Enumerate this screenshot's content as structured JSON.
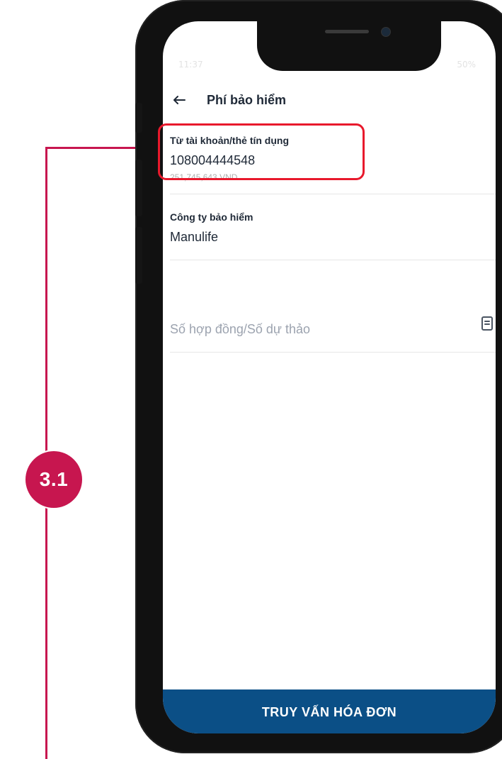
{
  "callout": {
    "badge_label": "3.1",
    "color": "#c7164f"
  },
  "status_bar": {
    "time": "11:37",
    "right_text": "50%"
  },
  "header": {
    "title": "Phí bảo hiểm",
    "back_icon": "arrow-left-icon"
  },
  "from_account": {
    "label": "Từ tài khoản/thẻ tín dụng",
    "value": "108004444548",
    "balance": "251,745,643 VND",
    "highlight_color": "#e8192c"
  },
  "insurance_company": {
    "label": "Công ty bảo hiểm",
    "value": "Manulife"
  },
  "contract_input": {
    "placeholder": "Số hợp đồng/Số dự thảo",
    "value": "",
    "icon": "document-icon"
  },
  "bottom_action": {
    "label": "TRUY VẤN HÓA ĐƠN",
    "color": "#0b4f86"
  }
}
